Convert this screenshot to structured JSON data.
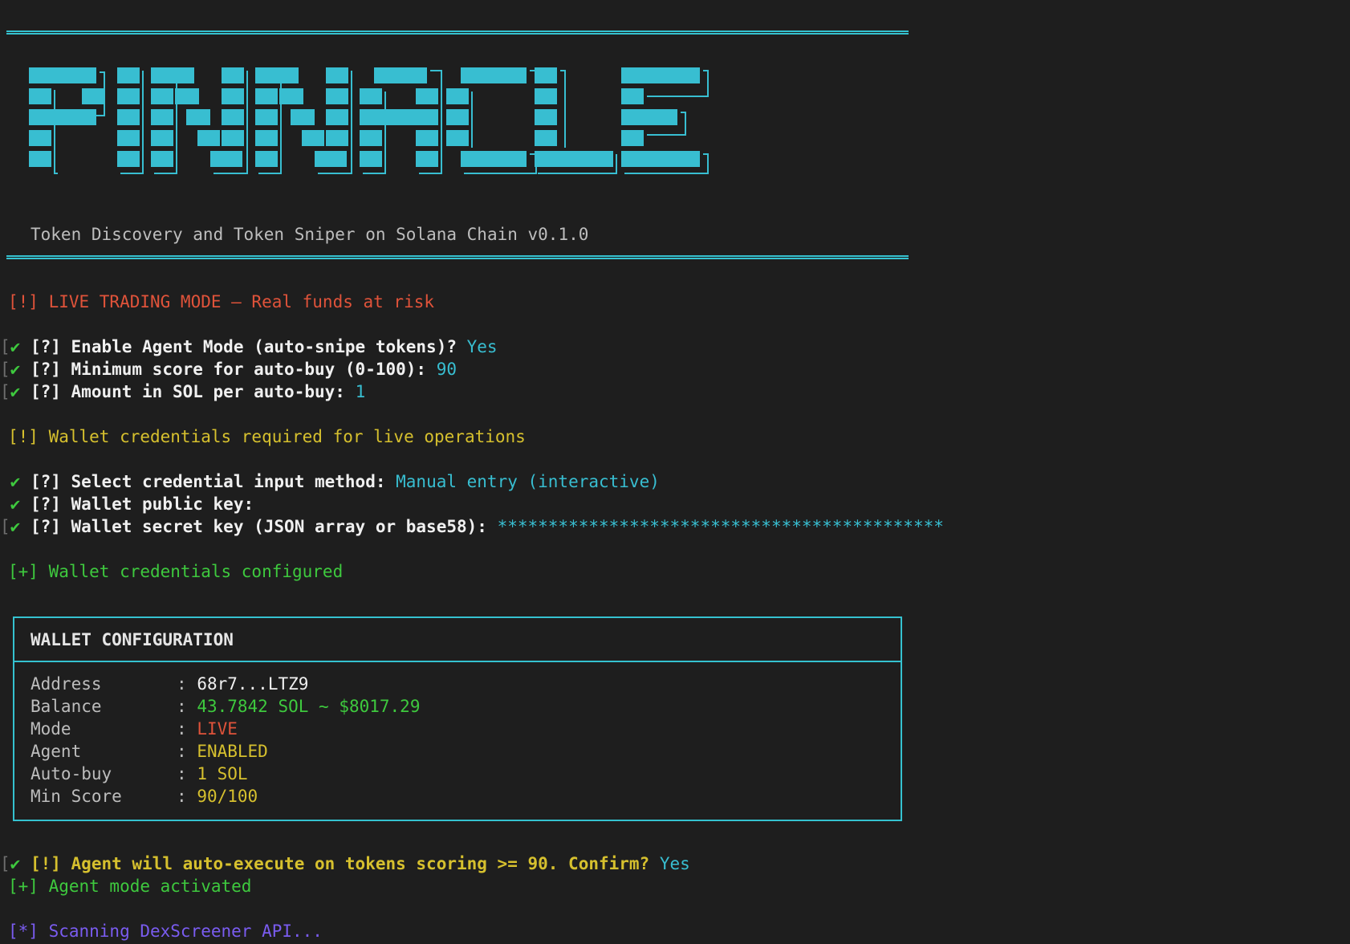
{
  "logo_text": "PINNACLE",
  "subtitle": "Token Discovery and Token Sniper on Solana Chain v0.1.0",
  "warning_live": "[!] LIVE TRADING MODE — Real funds at risk",
  "prompts": [
    {
      "check": "✔",
      "label": "[?] Enable Agent Mode (auto-snipe tokens)?",
      "answer": "Yes"
    },
    {
      "check": "✔",
      "label": "[?] Minimum score for auto-buy (0-100):",
      "answer": "90"
    },
    {
      "check": "✔",
      "label": "[?] Amount in SOL per auto-buy:",
      "answer": "1"
    }
  ],
  "warning_wallet": "[!] Wallet credentials required for live operations",
  "credential_prompts": [
    {
      "check": "✔",
      "label": "[?] Select credential input method:",
      "answer": "Manual entry (interactive)"
    },
    {
      "check": "✔",
      "label": "[?] Wallet public key:",
      "answer": ""
    },
    {
      "check": "✔",
      "label": "[?] Wallet secret key (JSON array or base58):",
      "answer": "********************************************"
    }
  ],
  "wallet_configured": "[+] Wallet credentials configured",
  "wallet_config": {
    "title": "WALLET CONFIGURATION",
    "rows": [
      {
        "key": "Address",
        "sep": ":",
        "value": "68r7...LTZ9",
        "color": "#f0f0f0"
      },
      {
        "key": "Balance",
        "sep": ":",
        "value": "43.7842 SOL ~ $8017.29",
        "color": "#3ec93e"
      },
      {
        "key": "Mode",
        "sep": ":",
        "value": "LIVE",
        "color": "#e0533a"
      },
      {
        "key": "Agent",
        "sep": ":",
        "value": "ENABLED",
        "color": "#d6c02e"
      },
      {
        "key": "Auto-buy",
        "sep": ":",
        "value": "1 SOL",
        "color": "#d6c02e"
      },
      {
        "key": "Min Score",
        "sep": ":",
        "value": "90/100",
        "color": "#d6c02e"
      }
    ]
  },
  "confirm_prompt": {
    "check": "✔",
    "label": "[!] Agent will auto-execute on tokens scoring >= 90. Confirm?",
    "answer": "Yes"
  },
  "agent_activated": "[+] Agent mode activated",
  "scanning": "[*] Scanning DexScreener API...",
  "colors": {
    "background": "#1e1e1e",
    "cyan": "#38bed1",
    "red": "#e0533a",
    "yellow": "#d6c02e",
    "green": "#3ec93e",
    "purple": "#7a5cf0"
  }
}
